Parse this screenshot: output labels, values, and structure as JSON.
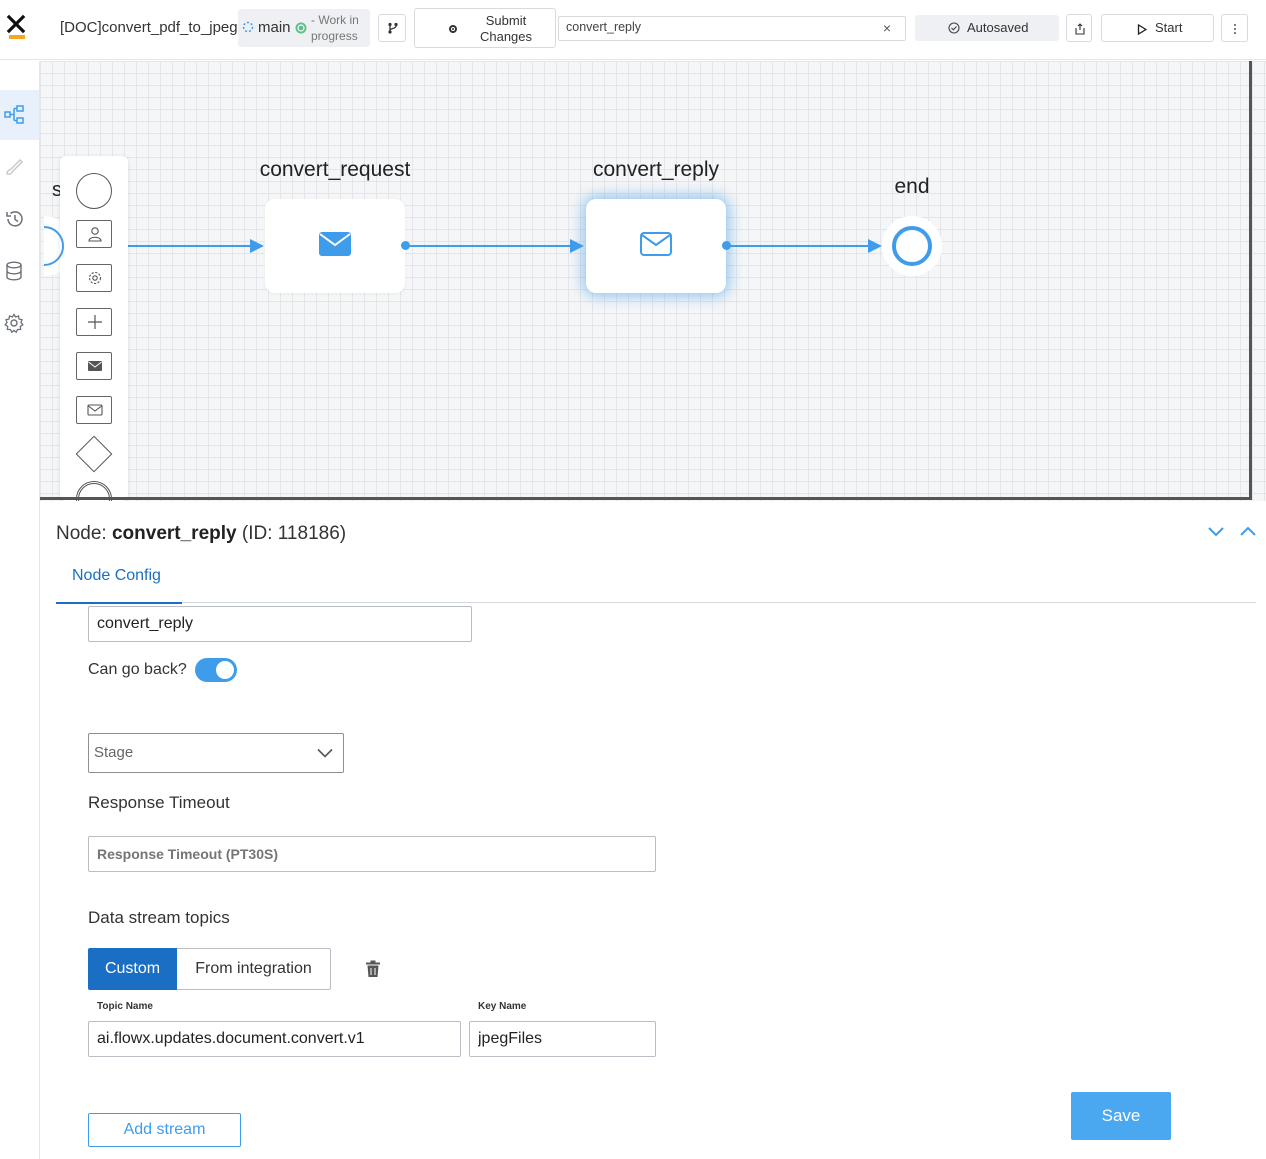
{
  "header": {
    "title": "[DOC]convert_pdf_to_jpeg",
    "branch": "main",
    "branch_status": "- Work in progress",
    "submit_label": "Submit Changes",
    "search_value": "convert_reply",
    "clear_symbol": "×",
    "autosaved_label": "Autosaved",
    "start_label": "Start"
  },
  "sidebar": {
    "items": [
      {
        "icon": "process-diagram-icon",
        "active": true
      },
      {
        "icon": "brush-icon",
        "active": false
      },
      {
        "icon": "history-icon",
        "active": false
      },
      {
        "icon": "database-icon",
        "active": false
      },
      {
        "icon": "settings-icon",
        "active": false
      }
    ]
  },
  "canvas": {
    "start_label_partial": "s",
    "nodes": {
      "request_label": "convert_request",
      "reply_label": "convert_reply",
      "end_label": "end"
    },
    "palette": [
      "start-event-icon",
      "user-task-icon",
      "service-task-icon",
      "subprocess-icon",
      "send-message-icon",
      "receive-message-icon",
      "gateway-icon",
      "end-event-icon"
    ]
  },
  "panel": {
    "title_prefix": "Node:",
    "node_name": "convert_reply",
    "node_id": "(ID: 118186)",
    "tab_label": "Node Config",
    "name_value": "convert_reply",
    "can_go_back_label": "Can go back?",
    "can_go_back": true,
    "stage_placeholder": "Stage",
    "response_timeout_label": "Response Timeout",
    "response_timeout_placeholder": "Response Timeout (PT30S)",
    "data_stream_label": "Data stream topics",
    "custom_label": "Custom",
    "from_integration_label": "From integration",
    "topic_name_label": "Topic Name",
    "topic_name_value": "ai.flowx.updates.document.convert.v1",
    "key_name_label": "Key Name",
    "key_name_value": "jpegFiles",
    "add_stream_label": "Add stream",
    "save_label": "Save"
  },
  "colors": {
    "accent": "#3e9ceb",
    "primary": "#1a6fc4",
    "logo_orange": "#f5a623"
  }
}
